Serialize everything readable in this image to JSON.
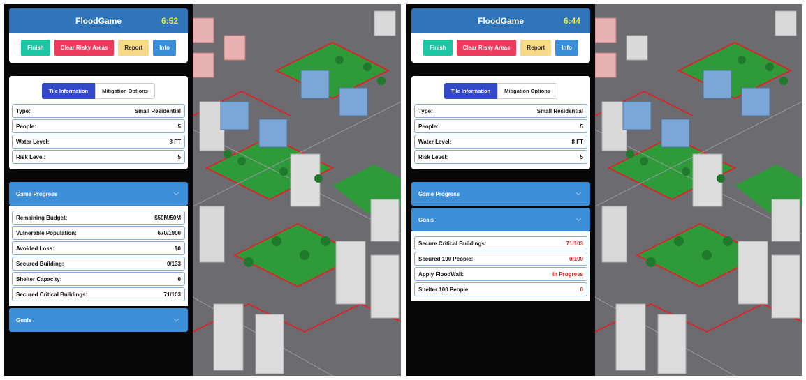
{
  "panes": [
    {
      "title": "FloodGame",
      "timer": "6:52",
      "buttons": {
        "finish": "Finish",
        "clear_risky": "Clear Risky Areas",
        "report": "Report",
        "info": "Info"
      },
      "tabs": {
        "tile_info": "Tile Information",
        "mitigation": "Mitigation Options"
      },
      "tile_info": [
        {
          "label": "Type:",
          "value": "Small Residential"
        },
        {
          "label": "People:",
          "value": "5"
        },
        {
          "label": "Water Level:",
          "value": "8 FT"
        },
        {
          "label": "Risk Level:",
          "value": "5"
        }
      ],
      "game_progress_label": "Game Progress",
      "game_progress": [
        {
          "label": "Remaining Budget:",
          "value": "$50M/50M"
        },
        {
          "label": "Vulnerable Population:",
          "value": "670/1900"
        },
        {
          "label": "Avoided Loss:",
          "value": "$0"
        },
        {
          "label": "Secured Building:",
          "value": "0/133"
        },
        {
          "label": "Shelter Capacity:",
          "value": "0"
        },
        {
          "label": "Secured Critical Buildings:",
          "value": "71/103"
        }
      ],
      "goals_label": "Goals"
    },
    {
      "title": "FloodGame",
      "timer": "6:44",
      "buttons": {
        "finish": "Finish",
        "clear_risky": "Clear Risky Areas",
        "report": "Report",
        "info": "Info"
      },
      "tabs": {
        "tile_info": "Tile Information",
        "mitigation": "Mitigation Options"
      },
      "tile_info": [
        {
          "label": "Type:",
          "value": "Small Residential"
        },
        {
          "label": "People:",
          "value": "5"
        },
        {
          "label": "Water Level:",
          "value": "8 FT"
        },
        {
          "label": "Risk Level:",
          "value": "5"
        }
      ],
      "game_progress_label": "Game Progress",
      "goals_label": "Goals",
      "goals": [
        {
          "label": "Secure Critical Buildings:",
          "value": "71/103"
        },
        {
          "label": "Secured 100 People:",
          "value": "0/100"
        },
        {
          "label": "Apply FloodWall:",
          "value": "In Progress"
        },
        {
          "label": "Shelter 100 People:",
          "value": "0"
        }
      ]
    }
  ],
  "colors": {
    "header": "#2f74b8",
    "timer": "#e4e83a",
    "finish": "#1dc6a2",
    "clear": "#ec3b5d",
    "report": "#f7d98a",
    "info": "#3a8ed7",
    "tab_active": "#3447c4",
    "accordion": "#3e8fd9",
    "goal_value": "#e61b1b",
    "grass": "#2f9a3a",
    "road": "#5f5f63",
    "flood_line": "#d9262b"
  }
}
